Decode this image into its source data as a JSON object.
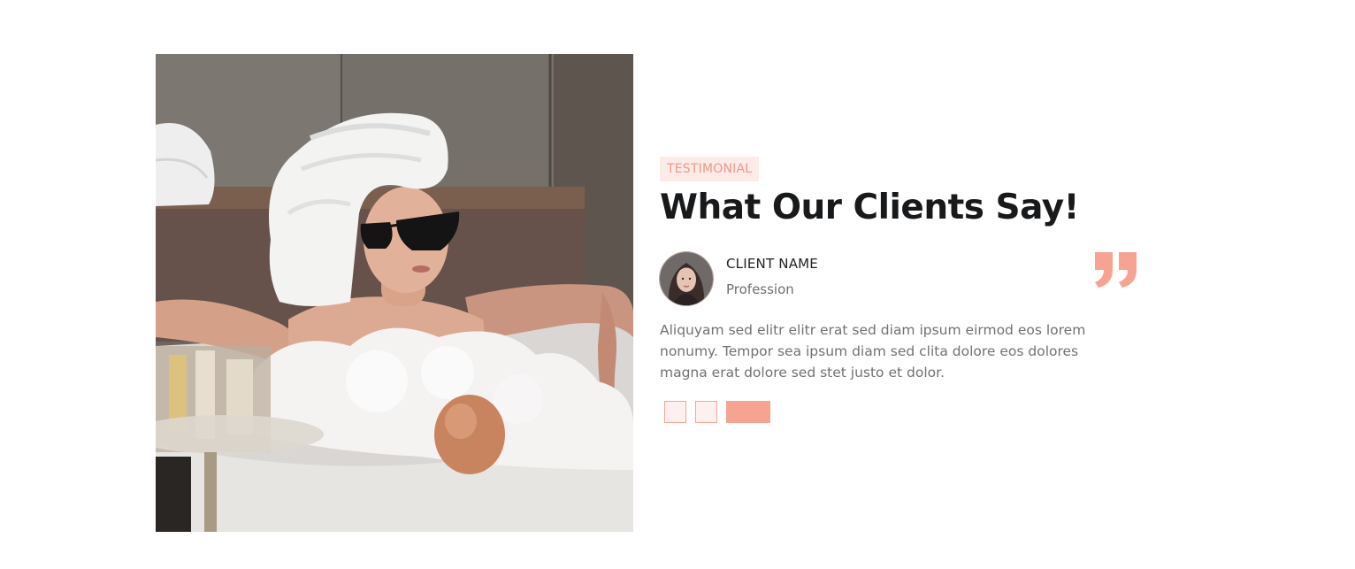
{
  "photo": {
    "icon": "woman-in-bathtub-photo"
  },
  "testimonial": {
    "badge": "TESTIMONIAL",
    "title": "What Our Clients Say!",
    "client": {
      "name": "CLIENT NAME",
      "profession": "Profession"
    },
    "text": "Aliquyam sed elitr elitr erat sed diam ipsum eirmod eos lorem nonumy. Tempor sea ipsum diam sed clita dolore eos dolores magna erat dolore sed stet justo et dolor.",
    "quote_icon": "quote-icon",
    "carousel": {
      "slide_count": 3,
      "active_index": 2
    }
  },
  "colors": {
    "accent": "#f7a392",
    "accent_light": "#fdebe7",
    "heading": "#17191b",
    "body_text": "#727272"
  }
}
